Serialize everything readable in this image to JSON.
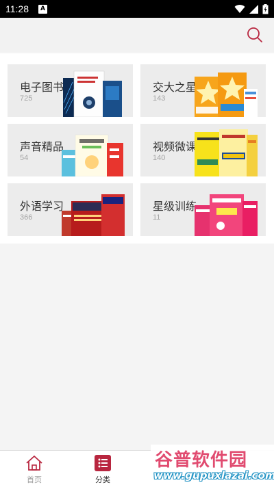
{
  "status_bar": {
    "time": "11:28",
    "app_icon_letter": "A"
  },
  "categories": [
    {
      "name": "电子图书",
      "count": "725",
      "art": "books"
    },
    {
      "name": "交大之星",
      "count": "143",
      "art": "stars"
    },
    {
      "name": "声音精品",
      "count": "54",
      "art": "audio"
    },
    {
      "name": "视频微课",
      "count": "140",
      "art": "video"
    },
    {
      "name": "外语学习",
      "count": "366",
      "art": "language"
    },
    {
      "name": "星级训练",
      "count": "11",
      "art": "training"
    }
  ],
  "tabs": [
    {
      "label": "首页",
      "icon": "home-icon",
      "active": false
    },
    {
      "label": "分类",
      "icon": "list-icon",
      "active": true
    }
  ],
  "watermark": {
    "title": "谷普软件园",
    "url": "www.gupuxlazai.com"
  },
  "colors": {
    "brand_red": "#b8263f",
    "card_bg": "#ececec",
    "page_bg": "#f4f4f4"
  }
}
